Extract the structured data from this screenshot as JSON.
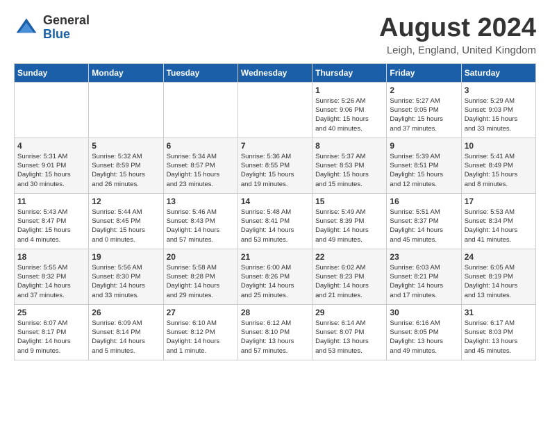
{
  "logo": {
    "general": "General",
    "blue": "Blue"
  },
  "title": "August 2024",
  "location": "Leigh, England, United Kingdom",
  "days_of_week": [
    "Sunday",
    "Monday",
    "Tuesday",
    "Wednesday",
    "Thursday",
    "Friday",
    "Saturday"
  ],
  "weeks": [
    [
      {
        "day": "",
        "info": ""
      },
      {
        "day": "",
        "info": ""
      },
      {
        "day": "",
        "info": ""
      },
      {
        "day": "",
        "info": ""
      },
      {
        "day": "1",
        "info": "Sunrise: 5:26 AM\nSunset: 9:06 PM\nDaylight: 15 hours\nand 40 minutes."
      },
      {
        "day": "2",
        "info": "Sunrise: 5:27 AM\nSunset: 9:05 PM\nDaylight: 15 hours\nand 37 minutes."
      },
      {
        "day": "3",
        "info": "Sunrise: 5:29 AM\nSunset: 9:03 PM\nDaylight: 15 hours\nand 33 minutes."
      }
    ],
    [
      {
        "day": "4",
        "info": "Sunrise: 5:31 AM\nSunset: 9:01 PM\nDaylight: 15 hours\nand 30 minutes."
      },
      {
        "day": "5",
        "info": "Sunrise: 5:32 AM\nSunset: 8:59 PM\nDaylight: 15 hours\nand 26 minutes."
      },
      {
        "day": "6",
        "info": "Sunrise: 5:34 AM\nSunset: 8:57 PM\nDaylight: 15 hours\nand 23 minutes."
      },
      {
        "day": "7",
        "info": "Sunrise: 5:36 AM\nSunset: 8:55 PM\nDaylight: 15 hours\nand 19 minutes."
      },
      {
        "day": "8",
        "info": "Sunrise: 5:37 AM\nSunset: 8:53 PM\nDaylight: 15 hours\nand 15 minutes."
      },
      {
        "day": "9",
        "info": "Sunrise: 5:39 AM\nSunset: 8:51 PM\nDaylight: 15 hours\nand 12 minutes."
      },
      {
        "day": "10",
        "info": "Sunrise: 5:41 AM\nSunset: 8:49 PM\nDaylight: 15 hours\nand 8 minutes."
      }
    ],
    [
      {
        "day": "11",
        "info": "Sunrise: 5:43 AM\nSunset: 8:47 PM\nDaylight: 15 hours\nand 4 minutes."
      },
      {
        "day": "12",
        "info": "Sunrise: 5:44 AM\nSunset: 8:45 PM\nDaylight: 15 hours\nand 0 minutes."
      },
      {
        "day": "13",
        "info": "Sunrise: 5:46 AM\nSunset: 8:43 PM\nDaylight: 14 hours\nand 57 minutes."
      },
      {
        "day": "14",
        "info": "Sunrise: 5:48 AM\nSunset: 8:41 PM\nDaylight: 14 hours\nand 53 minutes."
      },
      {
        "day": "15",
        "info": "Sunrise: 5:49 AM\nSunset: 8:39 PM\nDaylight: 14 hours\nand 49 minutes."
      },
      {
        "day": "16",
        "info": "Sunrise: 5:51 AM\nSunset: 8:37 PM\nDaylight: 14 hours\nand 45 minutes."
      },
      {
        "day": "17",
        "info": "Sunrise: 5:53 AM\nSunset: 8:34 PM\nDaylight: 14 hours\nand 41 minutes."
      }
    ],
    [
      {
        "day": "18",
        "info": "Sunrise: 5:55 AM\nSunset: 8:32 PM\nDaylight: 14 hours\nand 37 minutes."
      },
      {
        "day": "19",
        "info": "Sunrise: 5:56 AM\nSunset: 8:30 PM\nDaylight: 14 hours\nand 33 minutes."
      },
      {
        "day": "20",
        "info": "Sunrise: 5:58 AM\nSunset: 8:28 PM\nDaylight: 14 hours\nand 29 minutes."
      },
      {
        "day": "21",
        "info": "Sunrise: 6:00 AM\nSunset: 8:26 PM\nDaylight: 14 hours\nand 25 minutes."
      },
      {
        "day": "22",
        "info": "Sunrise: 6:02 AM\nSunset: 8:23 PM\nDaylight: 14 hours\nand 21 minutes."
      },
      {
        "day": "23",
        "info": "Sunrise: 6:03 AM\nSunset: 8:21 PM\nDaylight: 14 hours\nand 17 minutes."
      },
      {
        "day": "24",
        "info": "Sunrise: 6:05 AM\nSunset: 8:19 PM\nDaylight: 14 hours\nand 13 minutes."
      }
    ],
    [
      {
        "day": "25",
        "info": "Sunrise: 6:07 AM\nSunset: 8:17 PM\nDaylight: 14 hours\nand 9 minutes."
      },
      {
        "day": "26",
        "info": "Sunrise: 6:09 AM\nSunset: 8:14 PM\nDaylight: 14 hours\nand 5 minutes."
      },
      {
        "day": "27",
        "info": "Sunrise: 6:10 AM\nSunset: 8:12 PM\nDaylight: 14 hours\nand 1 minute."
      },
      {
        "day": "28",
        "info": "Sunrise: 6:12 AM\nSunset: 8:10 PM\nDaylight: 13 hours\nand 57 minutes."
      },
      {
        "day": "29",
        "info": "Sunrise: 6:14 AM\nSunset: 8:07 PM\nDaylight: 13 hours\nand 53 minutes."
      },
      {
        "day": "30",
        "info": "Sunrise: 6:16 AM\nSunset: 8:05 PM\nDaylight: 13 hours\nand 49 minutes."
      },
      {
        "day": "31",
        "info": "Sunrise: 6:17 AM\nSunset: 8:03 PM\nDaylight: 13 hours\nand 45 minutes."
      }
    ]
  ]
}
